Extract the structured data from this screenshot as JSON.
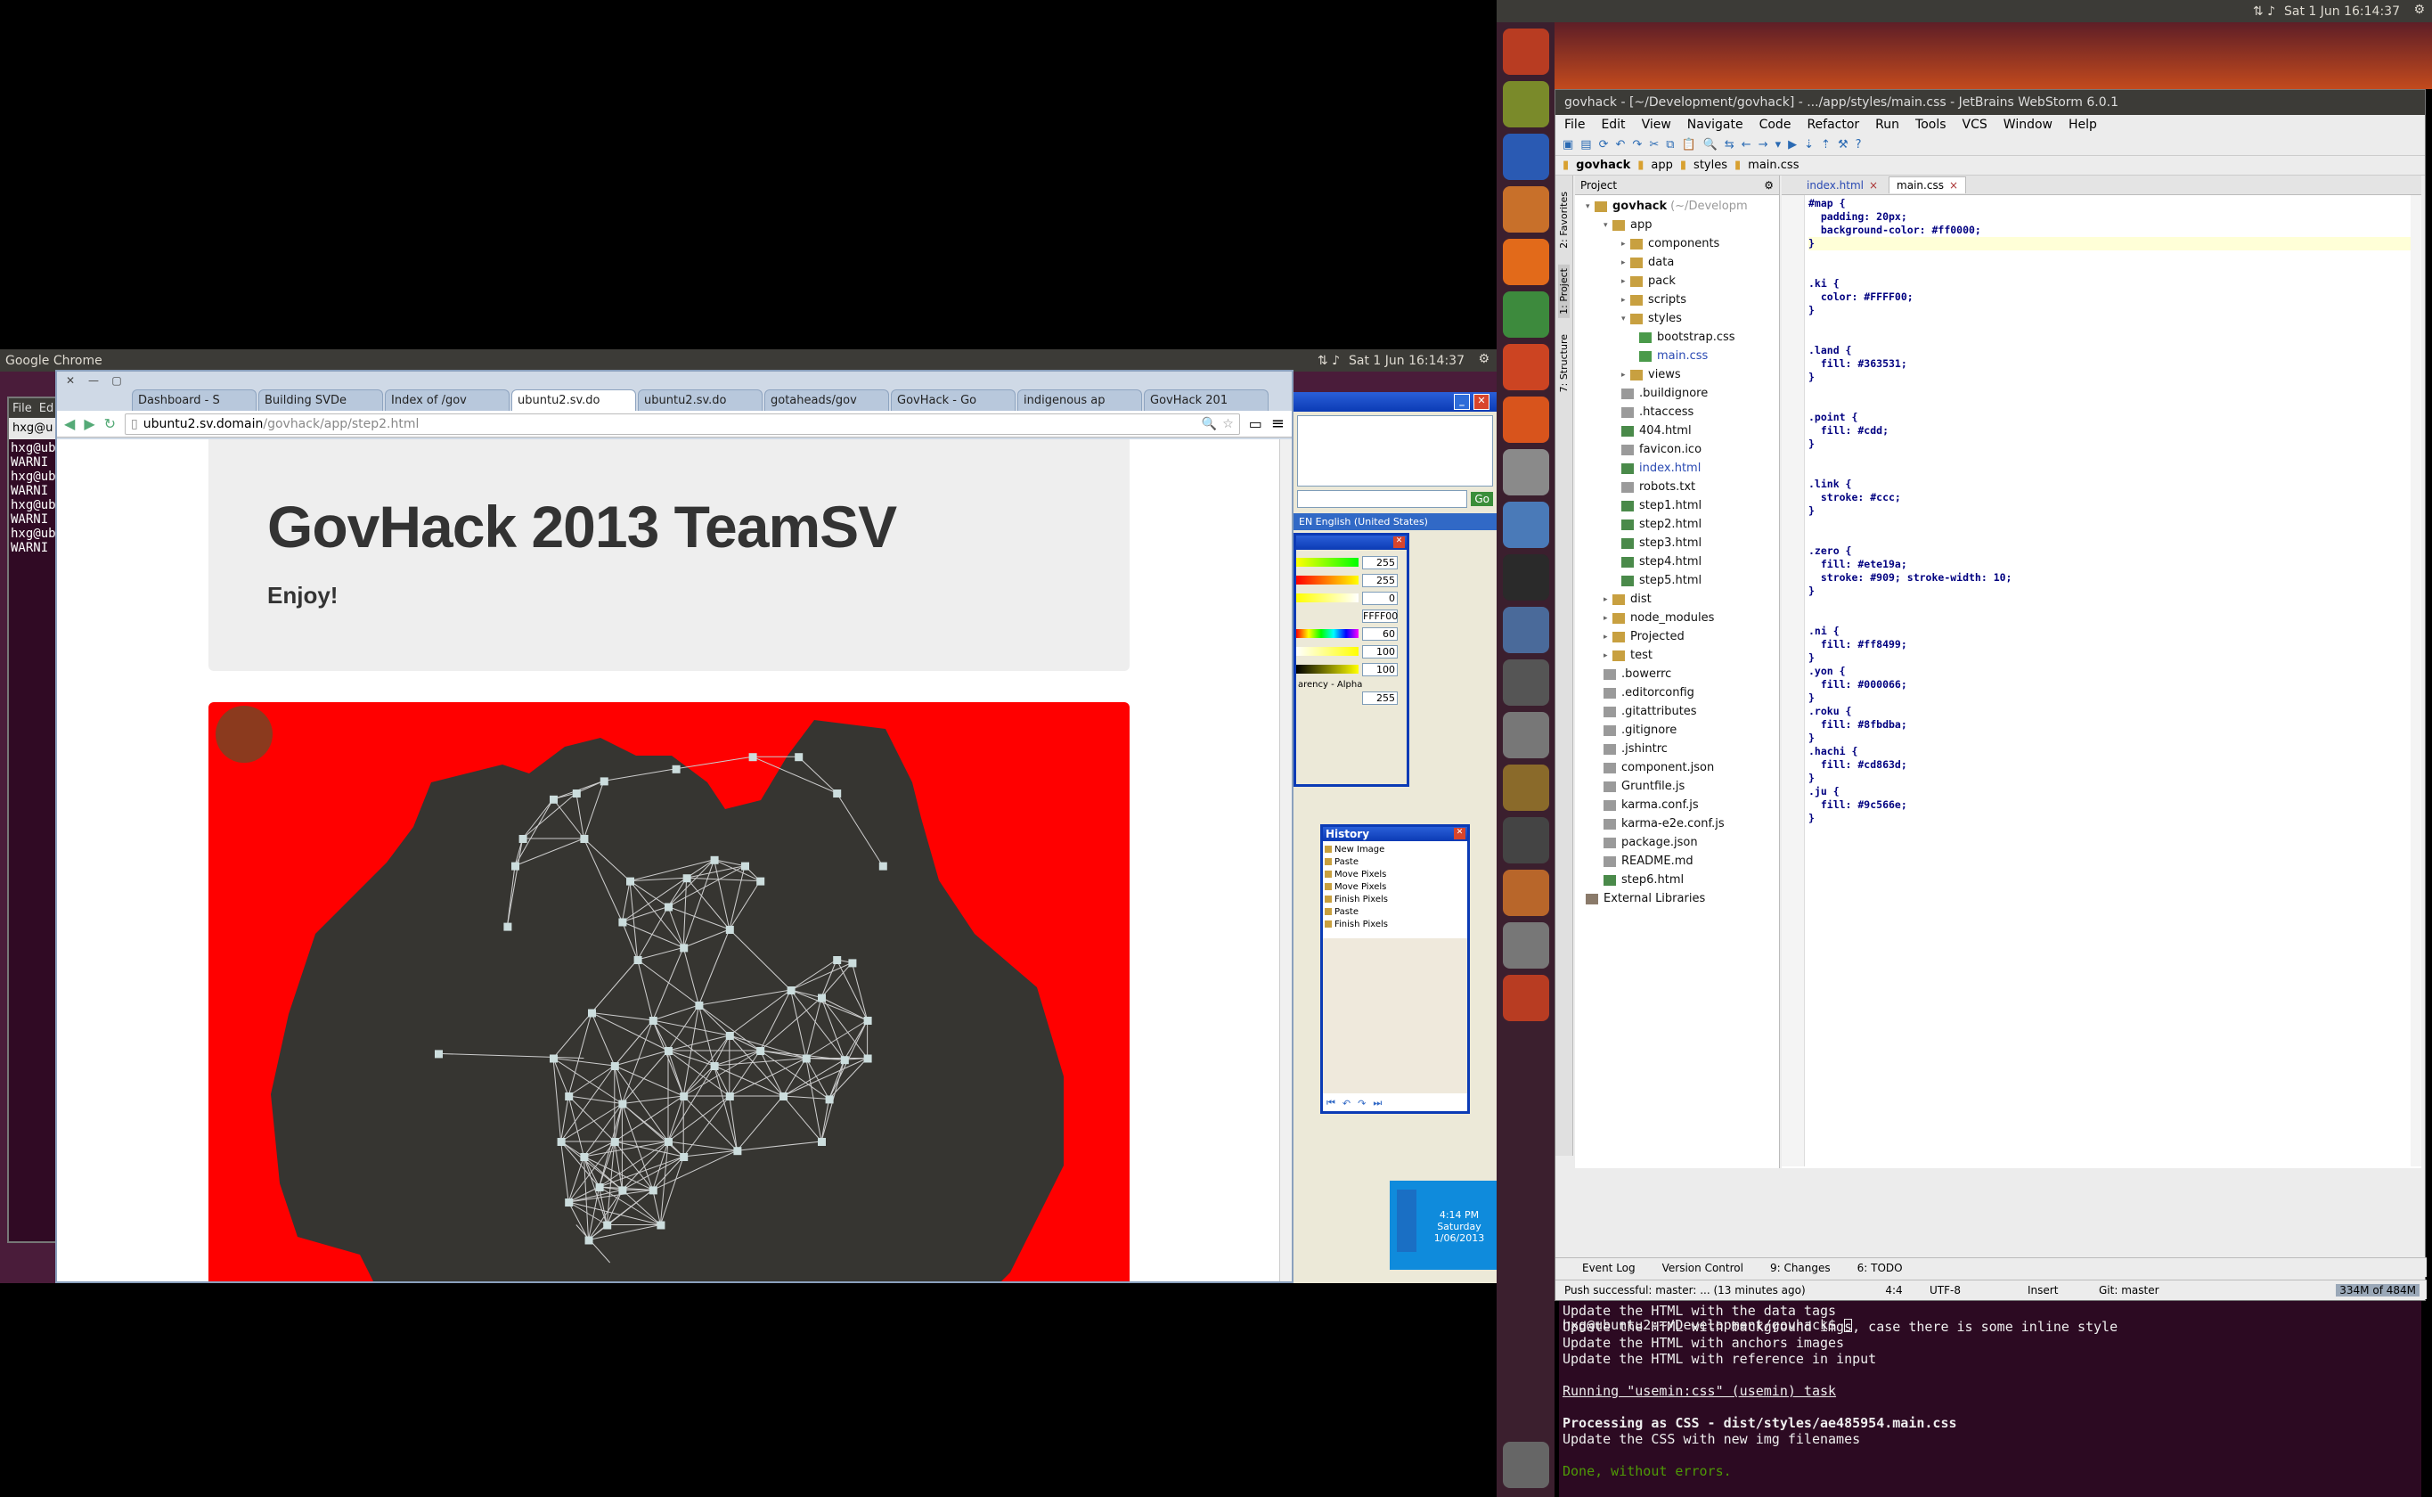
{
  "left_bar": {
    "app": "Google Chrome",
    "clock": "Sat  1 Jun 16:14:37"
  },
  "right_bar": {
    "clock": "Sat  1 Jun 16:14:37"
  },
  "chrome": {
    "tabs": [
      {
        "label": "Dashboard - S"
      },
      {
        "label": "Building SVDe"
      },
      {
        "label": "Index of /gov"
      },
      {
        "label": "ubuntu2.sv.do"
      },
      {
        "label": "ubuntu2.sv.do"
      },
      {
        "label": "gotaheads/gov"
      },
      {
        "label": "GovHack - Go"
      },
      {
        "label": "indigenous ap"
      },
      {
        "label": "GovHack 201"
      }
    ],
    "url_host": "ubuntu2.sv.domain",
    "url_path": "/govhack/app/step2.html",
    "heading": "GovHack 2013 TeamSV",
    "subheading": "Enjoy!"
  },
  "behind_terminal": {
    "menu_file": "File",
    "menu_edit": "Ed",
    "tab": "hxg@u",
    "lines": [
      "hxg@ub",
      "WARNI",
      "hxg@ub",
      "WARNI",
      "hxg@ub",
      "WARNI",
      "hxg@ub",
      "WARNI"
    ]
  },
  "xp": {
    "language": "EN English (United States)",
    "go": "Go",
    "color_values": [
      "255",
      "255",
      "0",
      "FFFF00",
      "60",
      "100",
      "100"
    ],
    "alpha_label": "arency - Alpha",
    "alpha_value": "255",
    "history_title": "History",
    "history_items": [
      "New Image",
      "Paste",
      "Move Pixels",
      "Move Pixels",
      "Finish Pixels",
      "Paste",
      "Finish Pixels"
    ],
    "tray_time": "4:14 PM",
    "tray_day": "Saturday",
    "tray_date": "1/06/2013"
  },
  "webstorm": {
    "title": "govhack - [~/Development/govhack] - .../app/styles/main.css - JetBrains WebStorm 6.0.1",
    "menu": [
      "File",
      "Edit",
      "View",
      "Navigate",
      "Code",
      "Refactor",
      "Run",
      "Tools",
      "VCS",
      "Window",
      "Help"
    ],
    "breadcrumbs": [
      "govhack",
      "app",
      "styles",
      "main.css"
    ],
    "project_label": "Project",
    "editor_tabs": [
      "index.html",
      "main.css"
    ],
    "tree": [
      {
        "label": "govhack",
        "extra": "(~/Developm",
        "indent": 0,
        "kind": "folder"
      },
      {
        "label": "app",
        "indent": 1,
        "kind": "folder"
      },
      {
        "label": "components",
        "indent": 2,
        "kind": "folder"
      },
      {
        "label": "data",
        "indent": 2,
        "kind": "folder"
      },
      {
        "label": "pack",
        "indent": 2,
        "kind": "folder"
      },
      {
        "label": "scripts",
        "indent": 2,
        "kind": "folder"
      },
      {
        "label": "styles",
        "indent": 2,
        "kind": "folder"
      },
      {
        "label": "bootstrap.css",
        "indent": 3,
        "kind": "css"
      },
      {
        "label": "main.css",
        "indent": 3,
        "kind": "css"
      },
      {
        "label": "views",
        "indent": 2,
        "kind": "folder"
      },
      {
        "label": ".buildignore",
        "indent": 2,
        "kind": "file"
      },
      {
        "label": ".htaccess",
        "indent": 2,
        "kind": "file"
      },
      {
        "label": "404.html",
        "indent": 2,
        "kind": "html"
      },
      {
        "label": "favicon.ico",
        "indent": 2,
        "kind": "file"
      },
      {
        "label": "index.html",
        "indent": 2,
        "kind": "html"
      },
      {
        "label": "robots.txt",
        "indent": 2,
        "kind": "file"
      },
      {
        "label": "step1.html",
        "indent": 2,
        "kind": "html"
      },
      {
        "label": "step2.html",
        "indent": 2,
        "kind": "html"
      },
      {
        "label": "step3.html",
        "indent": 2,
        "kind": "html"
      },
      {
        "label": "step4.html",
        "indent": 2,
        "kind": "html"
      },
      {
        "label": "step5.html",
        "indent": 2,
        "kind": "html"
      },
      {
        "label": "dist",
        "indent": 1,
        "kind": "folder"
      },
      {
        "label": "node_modules",
        "indent": 1,
        "kind": "folder"
      },
      {
        "label": "Projected",
        "indent": 1,
        "kind": "folder"
      },
      {
        "label": "test",
        "indent": 1,
        "kind": "folder"
      },
      {
        "label": ".bowerrc",
        "indent": 1,
        "kind": "file"
      },
      {
        "label": ".editorconfig",
        "indent": 1,
        "kind": "file"
      },
      {
        "label": ".gitattributes",
        "indent": 1,
        "kind": "file"
      },
      {
        "label": ".gitignore",
        "indent": 1,
        "kind": "file"
      },
      {
        "label": ".jshintrc",
        "indent": 1,
        "kind": "file"
      },
      {
        "label": "component.json",
        "indent": 1,
        "kind": "file"
      },
      {
        "label": "Gruntfile.js",
        "indent": 1,
        "kind": "file"
      },
      {
        "label": "karma.conf.js",
        "indent": 1,
        "kind": "file"
      },
      {
        "label": "karma-e2e.conf.js",
        "indent": 1,
        "kind": "file"
      },
      {
        "label": "package.json",
        "indent": 1,
        "kind": "file"
      },
      {
        "label": "README.md",
        "indent": 1,
        "kind": "file"
      },
      {
        "label": "step6.html",
        "indent": 1,
        "kind": "html"
      },
      {
        "label": "External Libraries",
        "indent": 0,
        "kind": "lib"
      }
    ],
    "code": [
      "#map {",
      "  padding: 20px;",
      "  background-color: #ff0000;",
      "}",
      "",
      "",
      ".ki {",
      "  color: #FFFF00;",
      "}",
      "",
      "",
      ".land {",
      "  fill: #363531;",
      "}",
      "",
      "",
      ".point {",
      "  fill: #cdd;",
      "}",
      "",
      "",
      ".link {",
      "  stroke: #ccc;",
      "}",
      "",
      "",
      ".zero {",
      "  fill: #ete19a;",
      "  stroke: #909; stroke-width: 10;",
      "}",
      "",
      "",
      ".ni {",
      "  fill: #ff8499;",
      "}",
      ".yon {",
      "  fill: #000066;",
      "}",
      ".roku {",
      "  fill: #8fbdba;",
      "}",
      ".hachi {",
      "  fill: #cd863d;",
      "}",
      ".ju {",
      "  fill: #9c566e;",
      "}"
    ],
    "side_tabs": [
      "2: Favorites",
      "1: Project",
      "7: Structure"
    ],
    "bottom_tabs": [
      "Event Log",
      "Version Control",
      "9: Changes",
      "6: TODO"
    ],
    "status": {
      "message": "Push successful: master: ... (13 minutes ago)",
      "pos": "4:4",
      "encoding": "UTF-8",
      "mode": "Insert",
      "branch": "Git: master",
      "memory": "334M of 484M"
    }
  },
  "terminal": {
    "lines": [
      "Update the HTML with the data tags",
      "Update the HTML with background imgs, case there is some inline style",
      "Update the HTML with anchors images",
      "Update the HTML with reference in input",
      "",
      "Running \"usemin:css\" (usemin) task",
      "",
      "Processing as CSS - dist/styles/ae485954.main.css",
      "Update the CSS with new img filenames",
      "",
      "Done, without errors."
    ],
    "prompt": "hxg@ubuntu2:~/Development/govhack$ "
  },
  "colors": {
    "map_bg": "#ff0000",
    "land": "#363531",
    "ubuntu_orange": "#dd4814"
  }
}
